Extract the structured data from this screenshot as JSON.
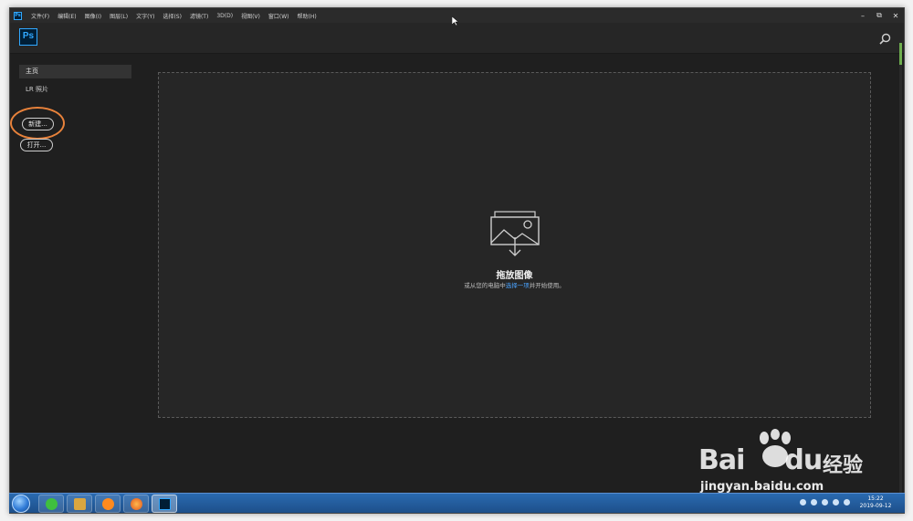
{
  "app": {
    "mini_logo": "Ps",
    "logo": "Ps",
    "menu": [
      "文件(F)",
      "编辑(E)",
      "图像(I)",
      "图层(L)",
      "文字(Y)",
      "选择(S)",
      "滤镜(T)",
      "3D(D)",
      "视图(V)",
      "窗口(W)",
      "帮助(H)"
    ],
    "window_controls": {
      "minimize": "–",
      "restore": "⧉",
      "close": "✕"
    },
    "accent_color": "#31a8ff"
  },
  "sidebar": {
    "home_label": "主页",
    "lr_label": "LR 照片",
    "new_button": "新建...",
    "open_button": "打开..."
  },
  "dropzone": {
    "title": "拖放图像",
    "sub_before": "或从您的电脑中",
    "sub_link": "选择一项",
    "sub_after": "并开始使用。"
  },
  "taskbar": {
    "time": "15:22",
    "date": "2019-09-12",
    "apps": [
      "refresh-icon",
      "notes-icon",
      "browser-icon",
      "firefox-icon",
      "photoshop-icon"
    ]
  },
  "watermark": {
    "brand": "Bai",
    "brand_suffix": "du",
    "cn": "经验",
    "url": "jingyan.baidu.com"
  }
}
